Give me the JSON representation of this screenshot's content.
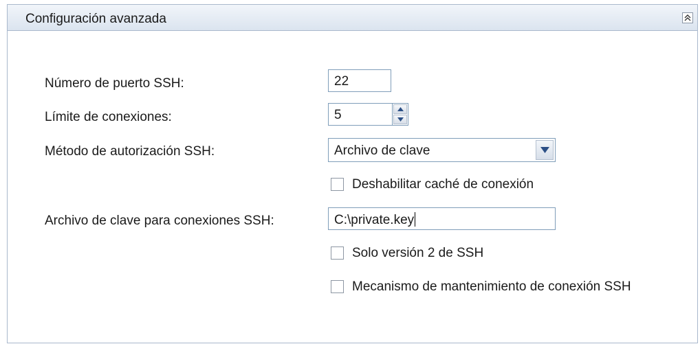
{
  "panel": {
    "title": "Configuración avanzada",
    "collapse_icon": "double-chevron-up-icon"
  },
  "form": {
    "port_label": "Número de puerto SSH:",
    "port_value": "22",
    "conn_limit_label": "Límite de conexiones:",
    "conn_limit_value": "5",
    "auth_label": "Método de autorización SSH:",
    "auth_value": "Archivo de clave",
    "disable_cache_label": "Deshabilitar caché de conexión",
    "disable_cache_checked": false,
    "key_file_label": "Archivo de clave para conexiones SSH:",
    "key_file_value": "C:\\private.key",
    "ssh_v2_label": "Solo versión 2 de SSH",
    "ssh_v2_checked": false,
    "keepalive_label": "Mecanismo de mantenimiento de conexión SSH",
    "keepalive_checked": false
  },
  "colors": {
    "header_bg": "#dbe4ef",
    "border": "#7f9db9",
    "arrow": "#2b4f86"
  }
}
